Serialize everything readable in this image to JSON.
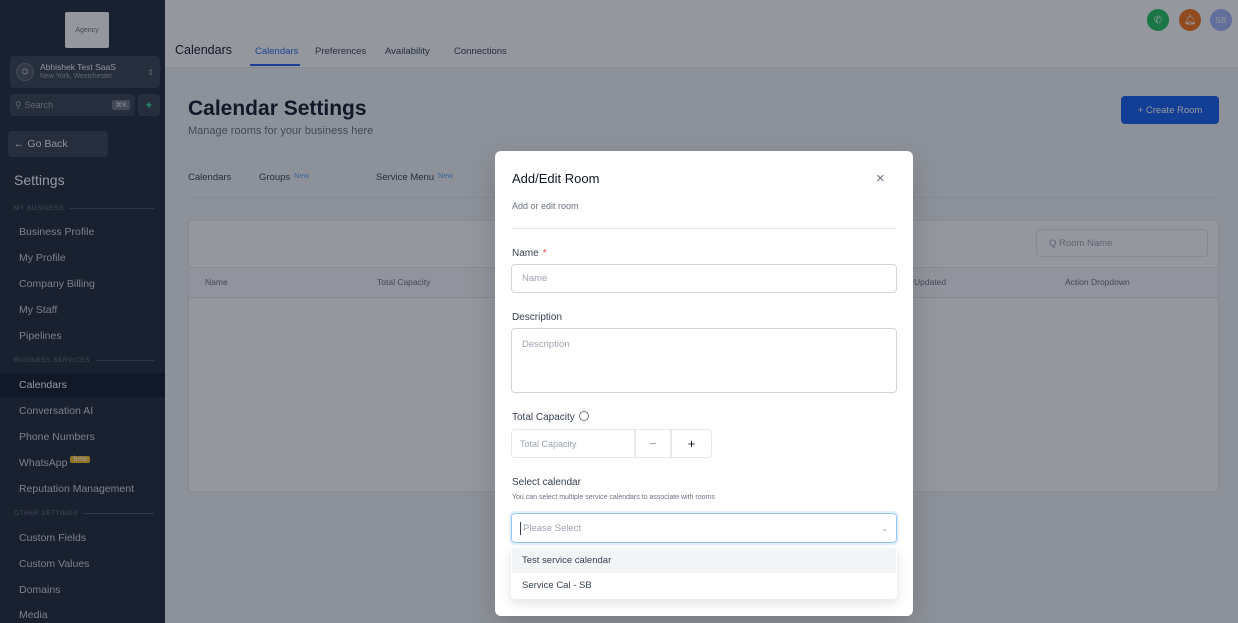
{
  "sidebar": {
    "logo": "Agency",
    "account": {
      "avatar": "⛭",
      "name": "Abhishek Test SaaS",
      "location": "New York, Westchester"
    },
    "search": {
      "placeholder": "Search",
      "shortcut": "⌘K"
    },
    "go_back": "← Go Back",
    "title": "Settings",
    "sections": [
      "MY BUSINESS",
      "BUSINESS SERVICES",
      "OTHER SETTINGS"
    ],
    "items": [
      {
        "label": "Business Profile"
      },
      {
        "label": "My Profile"
      },
      {
        "label": "Company Billing"
      },
      {
        "label": "My Staff"
      },
      {
        "label": "Pipelines"
      },
      {
        "label": "Calendars"
      },
      {
        "label": "Conversation AI"
      },
      {
        "label": "Phone Numbers"
      },
      {
        "label": "WhatsApp"
      },
      {
        "label": "Reputation Management"
      },
      {
        "label": "Custom Fields"
      },
      {
        "label": "Custom Values"
      },
      {
        "label": "Domains"
      },
      {
        "label": "Media"
      }
    ],
    "whatsapp_badge": "beta"
  },
  "topbar": {
    "title": "Calendars",
    "tabs": [
      "Calendars",
      "Preferences",
      "Availability",
      "Connections"
    ],
    "avatar": "SB"
  },
  "main": {
    "title": "Calendar Settings",
    "subtitle": "Manage rooms for your business here",
    "create_button": "+ Create Room",
    "subtabs": [
      "Calendars",
      "Groups",
      "Service Menu"
    ],
    "new_badge": "New",
    "room_search_placeholder": "Q Room Name",
    "columns": [
      "Name",
      "Total Capacity",
      "Updated",
      "Action Dropdown"
    ]
  },
  "modal": {
    "title": "Add/Edit Room",
    "close": "×",
    "subtitle": "Add or edit room",
    "name_label": "Name",
    "required": "*",
    "name_placeholder": "Name",
    "description_label": "Description",
    "description_placeholder": "Description",
    "capacity_label": "Total Capacity",
    "capacity_placeholder": "Total Capacity",
    "minus": "−",
    "plus": "+",
    "calendar_label": "Select calendar",
    "calendar_hint": "You can select multiple service calendars to associate with rooms",
    "calendar_placeholder": "Please Select",
    "options": [
      "Test service calendar",
      "Service Cal - SB"
    ]
  },
  "colors": {
    "accent": "#155eef",
    "sidebar_bg": "#1f2937",
    "phone": "#22c55e",
    "bell": "#f97316",
    "avatar": "#a5b4fc"
  },
  "icons": [
    "chevron-up-down-icon",
    "search-icon",
    "plus-icon",
    "phone-icon",
    "bell-icon",
    "close-icon",
    "info-icon",
    "chevron-down-icon"
  ]
}
